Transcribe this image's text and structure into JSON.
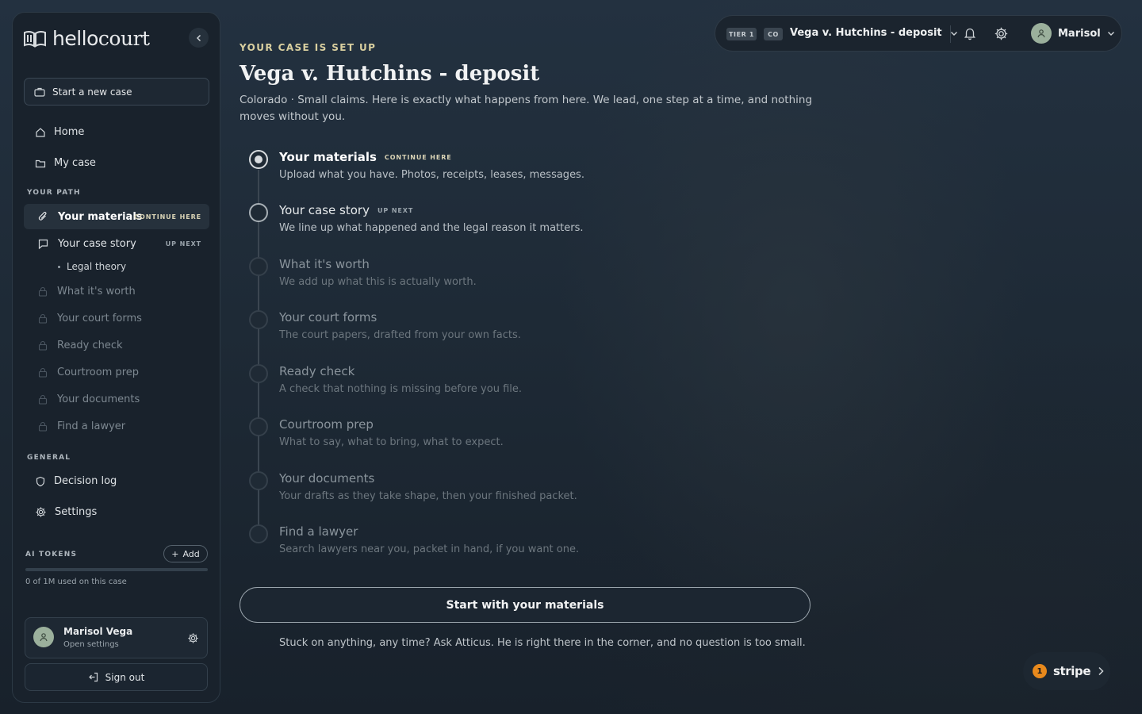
{
  "brand": {
    "name_part1": "hello",
    "name_part2": "court"
  },
  "sidebar": {
    "new_case_label": "Start a new case",
    "nav": [
      {
        "label": "Home",
        "icon": "home-icon"
      },
      {
        "label": "My case",
        "icon": "folder-icon"
      }
    ],
    "path_section_label": "YOUR PATH",
    "path": [
      {
        "label": "Your materials",
        "tag": "CONTINUE HERE",
        "state": "active"
      },
      {
        "label": "Your case story",
        "tag": "UP NEXT",
        "state": "next"
      },
      {
        "label": "What it's worth",
        "state": "locked"
      },
      {
        "label": "Your court forms",
        "state": "locked"
      },
      {
        "label": "Ready check",
        "state": "locked"
      },
      {
        "label": "Courtroom prep",
        "state": "locked"
      },
      {
        "label": "Your documents",
        "state": "locked"
      },
      {
        "label": "Find a lawyer",
        "state": "locked"
      }
    ],
    "sub_item": "Legal theory",
    "general_section_label": "GENERAL",
    "general": [
      {
        "label": "Decision log",
        "icon": "shield-icon"
      },
      {
        "label": "Settings",
        "icon": "gear-icon"
      }
    ],
    "tokens": {
      "label": "AI TOKENS",
      "add_label": "Add",
      "used_fraction": 0,
      "note": "0 of 1M used on this case"
    },
    "user": {
      "name": "Marisol Vega",
      "sub": "Open settings"
    },
    "signout_label": "Sign out"
  },
  "main": {
    "eyebrow": "YOUR CASE IS SET UP",
    "title": "Vega v. Hutchins - deposit",
    "lede": "Colorado · Small claims. Here is exactly what happens from here. We lead, one step at a time, and nothing moves without you.",
    "steps": [
      {
        "title": "Your materials",
        "tag": "CONTINUE HERE",
        "desc": "Upload what you have. Photos, receipts, leases, messages.",
        "state": "active"
      },
      {
        "title": "Your case story",
        "tag": "UP NEXT",
        "desc": "We line up what happened and the legal reason it matters.",
        "state": "next"
      },
      {
        "title": "What it's worth",
        "desc": "We add up what this is actually worth.",
        "state": "locked"
      },
      {
        "title": "Your court forms",
        "desc": "The court papers, drafted from your own facts.",
        "state": "locked"
      },
      {
        "title": "Ready check",
        "desc": "A check that nothing is missing before you file.",
        "state": "locked"
      },
      {
        "title": "Courtroom prep",
        "desc": "What to say, what to bring, what to expect.",
        "state": "locked"
      },
      {
        "title": "Your documents",
        "desc": "Your drafts as they take shape, then your finished packet.",
        "state": "locked"
      },
      {
        "title": "Find a lawyer",
        "desc": "Search lawyers near you, packet in hand, if you want one.",
        "state": "locked"
      }
    ],
    "cta_label": "Start with your materials",
    "help_text": "Stuck on anything, any time? Ask Atticus. He is right there in the corner, and no question is too small."
  },
  "topbar": {
    "tier": "TIER 1",
    "state": "CO",
    "case_name": "Vega v. Hutchins - deposit",
    "profile_name": "Marisol"
  },
  "stripe": {
    "badge_count": "1",
    "label": "stripe"
  },
  "colors": {
    "accent": "#d9cf9f",
    "background": "#1e2a36",
    "sidebar": "#19222c",
    "avatar": "#9bb09c",
    "stripe_badge": "#e8891c"
  }
}
